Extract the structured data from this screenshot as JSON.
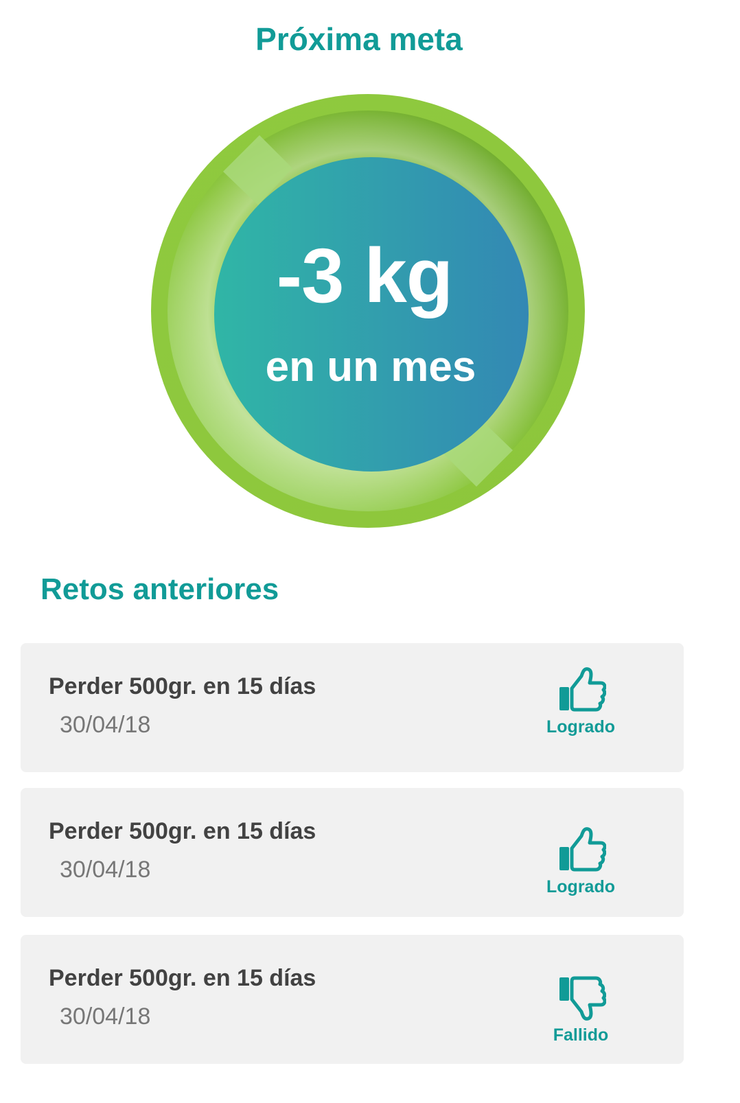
{
  "header": {
    "title": "Próxima meta"
  },
  "goal": {
    "amount": "-3 kg",
    "period": "en un mes"
  },
  "previous": {
    "title": "Retos anteriores",
    "items": [
      {
        "title": "Perder 500gr. en 15 días",
        "date": "30/04/18",
        "status": "Logrado",
        "icon": "thumbs-up-icon"
      },
      {
        "title": "Perder 500gr. en 15 días",
        "date": "30/04/18",
        "status": "Logrado",
        "icon": "thumbs-up-icon"
      },
      {
        "title": "Perder 500gr. en 15 días",
        "date": "30/04/18",
        "status": "Fallido",
        "icon": "thumbs-down-icon"
      }
    ]
  },
  "colors": {
    "accent": "#119b97",
    "ring_green": "#8cc63e",
    "inner_start": "#2fb3a5",
    "inner_end": "#3189b3",
    "card_bg": "#f1f1f1"
  }
}
